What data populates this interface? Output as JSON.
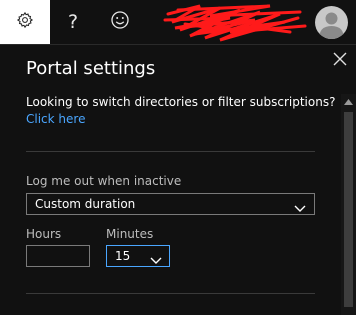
{
  "topbar": {
    "settings_icon": "gear-icon",
    "help_label": "?",
    "help_icon": "question-icon",
    "feedback_icon": "smiley-icon",
    "account_name_redacted": true,
    "avatar_icon": "person-icon"
  },
  "panel": {
    "title": "Portal settings",
    "close_icon": "close-icon",
    "intro_text": "Looking to switch directories or filter subscriptions?",
    "link_text": "Click here"
  },
  "signout": {
    "label": "Log me out when inactive",
    "selected": "Custom duration",
    "hours_label": "Hours",
    "hours_value": "",
    "minutes_label": "Minutes",
    "minutes_selected": "15"
  },
  "colors": {
    "background": "#111111",
    "link": "#4aa6ff",
    "focus_border": "#4aa6ff",
    "redaction": "#ff1a1a"
  }
}
